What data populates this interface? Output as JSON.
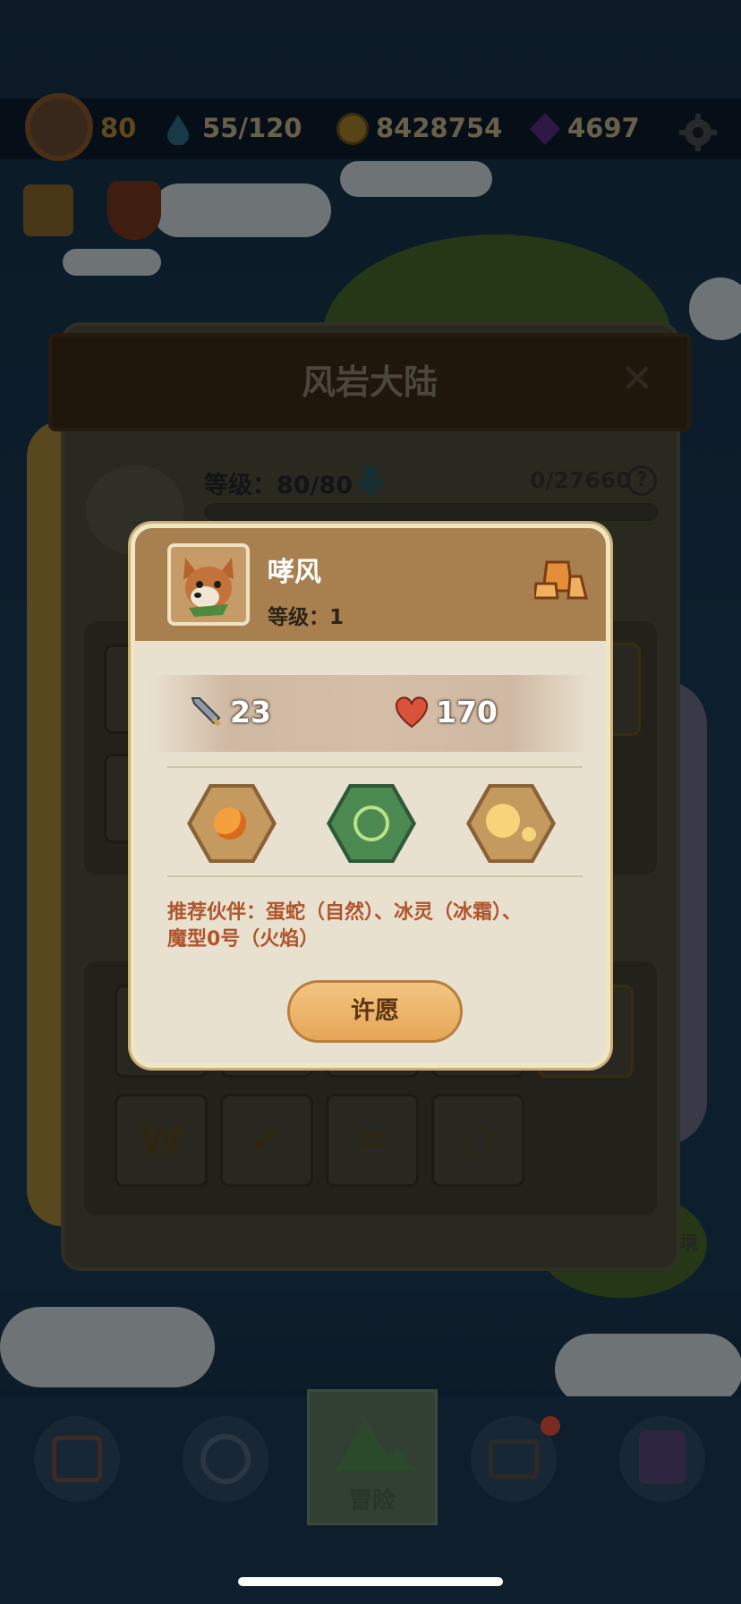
{
  "top_bar": {
    "player_level": "80",
    "energy": "55/120",
    "coins": "8428754",
    "gems": "4697"
  },
  "icons": {
    "settings": "gear-icon",
    "tasks": "checklist-icon",
    "guild": "paw-shield-icon",
    "energy": "water-drop-icon",
    "coins": "paw-coin-icon",
    "gems": "purple-gem-icon"
  },
  "region_panel": {
    "title": "风岩大陆",
    "level_label": "等级：80/80",
    "progress": "0/27660",
    "progress_fraction": 0,
    "help": "?",
    "side_label": "境",
    "slot_icons": [
      "W",
      "✔",
      "=",
      "⬡"
    ]
  },
  "hero_modal": {
    "name": "哮风",
    "level_label": "等级：1",
    "attack": "23",
    "health": "170",
    "element_icons": [
      "fire-drop-icon",
      "wind-leaf-icon",
      "light-orb-icon"
    ],
    "recommendation_line1": "推荐伙伴：蛋蛇（自然）、冰灵（冰霜）、",
    "recommendation_line2": "魔型0号（火焰）",
    "wish_button": "许愿"
  },
  "bottom_nav": {
    "active_label": "冒险"
  },
  "colors": {
    "modal_bg": "#e9e1cf",
    "modal_header": "#a8804f",
    "recommend_text": "#b0542c",
    "wish_button": "#e6a658"
  }
}
